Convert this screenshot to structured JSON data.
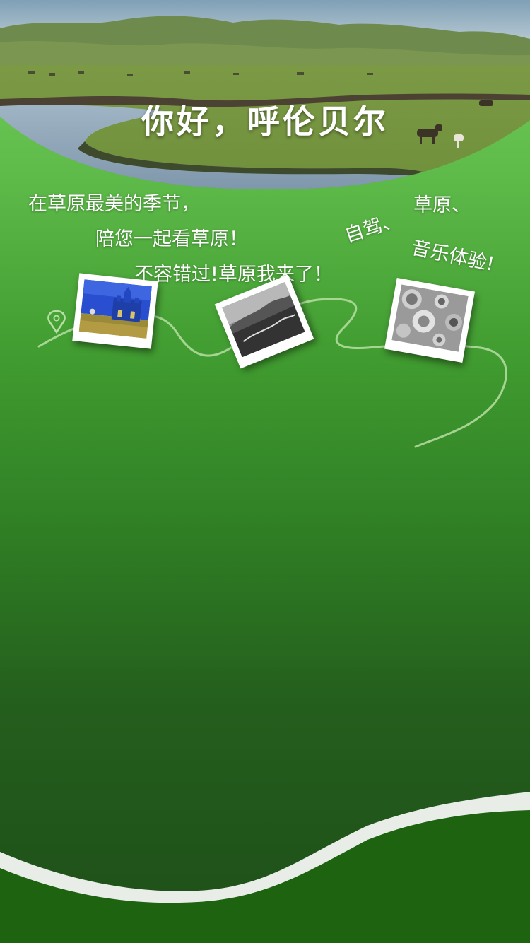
{
  "page": {
    "title": "你好，呼伦贝尔"
  },
  "captions": {
    "line1": "在草原最美的季节，",
    "line2": "陪您一起看草原！",
    "line3": "不容错过!草原我来了！",
    "tag_drive": "自驾、",
    "tag_grassland": "草原、",
    "tag_music": "音乐体验!"
  },
  "icons": {
    "start_marker": "location-pin-icon"
  },
  "colors": {
    "background_top": "#78d35e",
    "background_bottom": "#1e4f18",
    "bottom_wave": "#e8ede8",
    "bottom_fill": "#1d6310",
    "text": "#ffffff"
  }
}
